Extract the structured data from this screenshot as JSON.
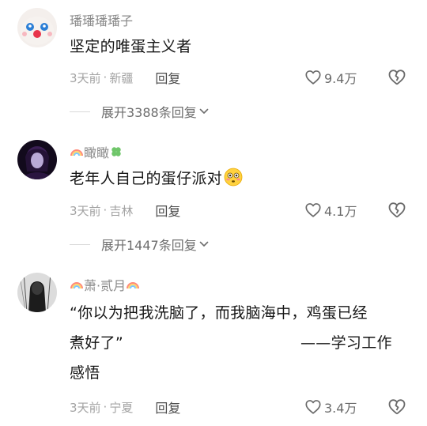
{
  "comments": [
    {
      "username": "璠璠璠璠子",
      "content": "坚定的唯蛋主义者",
      "time": "3天前",
      "location": "新疆",
      "reply_label": "回复",
      "likes": "9.4万",
      "expand_label": "展开3388条回复",
      "avatar_icon": "clown-face-avatar"
    },
    {
      "username": "瞰瞰",
      "content": "老年人自己的蛋仔派对",
      "time": "3天前",
      "location": "吉林",
      "reply_label": "回复",
      "likes": "4.1万",
      "expand_label": "展开1447条回复",
      "avatar_icon": "dark-figure-avatar",
      "emoji_icon": "flushed-face-emoji"
    },
    {
      "username": "萧·贰月",
      "content_line1": "“你以为把我洗脑了，而我脑海中，鸡蛋已经",
      "content_line2": "煮好了”",
      "content_attribution": "——学习工作",
      "content_line3": "感悟",
      "time": "3天前",
      "location": "宁夏",
      "reply_label": "回复",
      "likes": "3.4万",
      "avatar_icon": "sketch-portrait-avatar"
    }
  ],
  "colors": {
    "meta_gray": "#a3a3a3",
    "text_dark": "#161616",
    "accent_rainbow": [
      "#ff6b6b",
      "#ffd93d",
      "#6bcB77",
      "#4d96ff"
    ]
  }
}
